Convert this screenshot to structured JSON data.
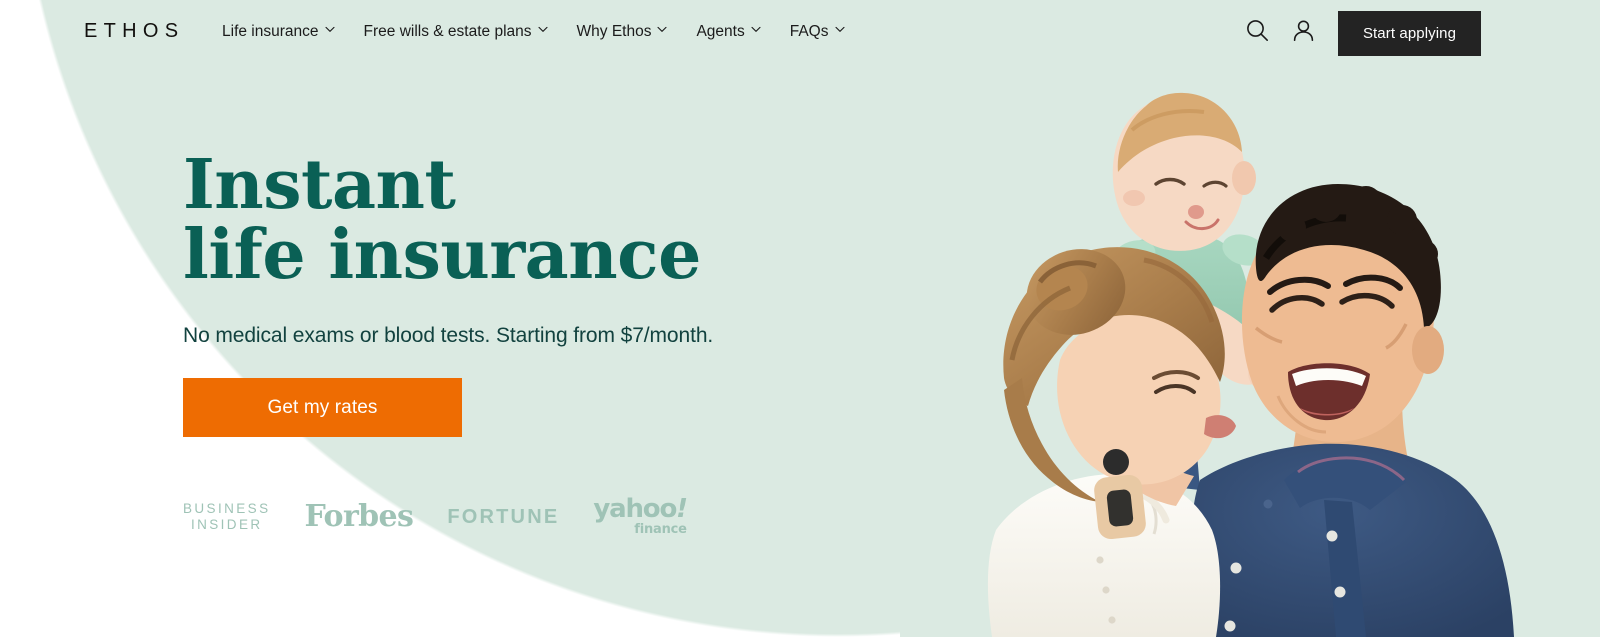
{
  "brand": {
    "logo_text": "ETHOS",
    "accent_orange": "#ee6c02",
    "deep_teal": "#0a6055",
    "mint_background": "#dbeae2",
    "dark_button": "#232323",
    "press_logo_color": "#9fc3b6"
  },
  "nav": {
    "items": [
      {
        "label": "Life insurance",
        "has_dropdown": true
      },
      {
        "label": "Free wills & estate plans",
        "has_dropdown": true
      },
      {
        "label": "Why Ethos",
        "has_dropdown": true
      },
      {
        "label": "Agents",
        "has_dropdown": true
      },
      {
        "label": "FAQs",
        "has_dropdown": true
      }
    ],
    "search_icon": "search-icon",
    "account_icon": "user-account-icon",
    "cta_label": "Start applying"
  },
  "hero": {
    "headline_line1": "Instant",
    "headline_line2": "life insurance",
    "headline": "Instant\nlife insurance",
    "subhead": "No medical exams or blood tests. Starting from $7/month.",
    "cta_label": "Get my rates",
    "image_alt": "Family: father laughing, mother kissing his cheek, baby on his shoulders"
  },
  "press": {
    "logos": [
      {
        "name": "business-insider",
        "line1": "BUSINESS",
        "line2": "INSIDER",
        "text": "BUSINESS\nINSIDER"
      },
      {
        "name": "forbes",
        "text": "Forbes"
      },
      {
        "name": "fortune",
        "text": "FORTUNE"
      },
      {
        "name": "yahoo-finance",
        "text": "yahoo",
        "bang": "!",
        "sub": "finance"
      }
    ]
  }
}
